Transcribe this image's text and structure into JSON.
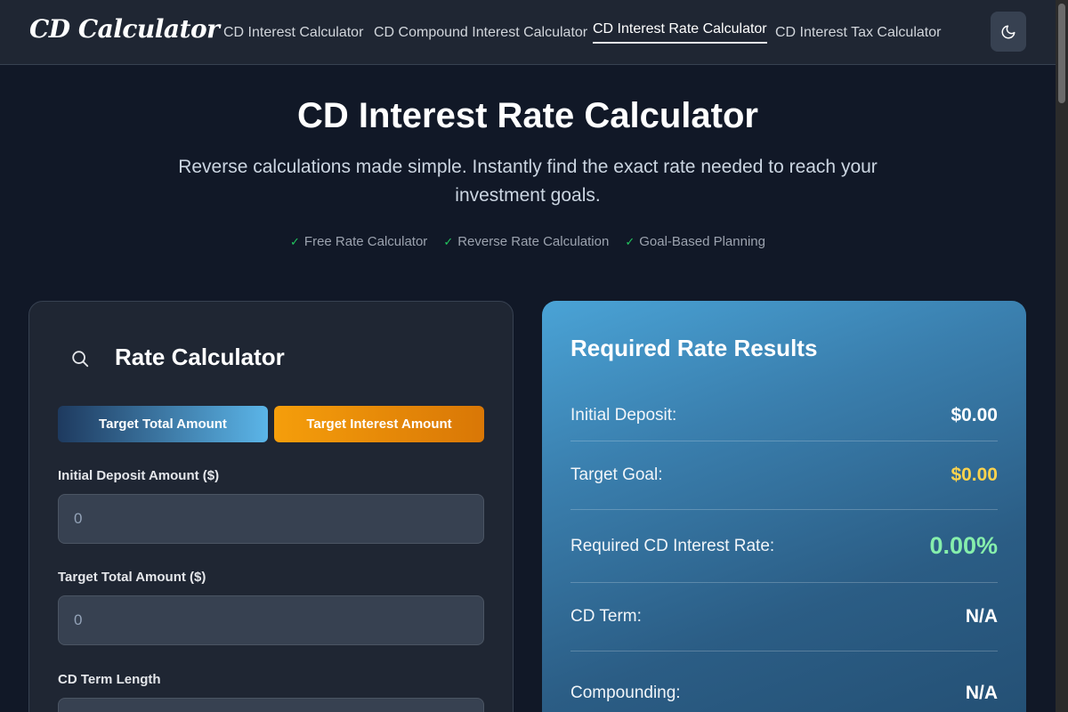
{
  "header": {
    "logo": "CD Calculator",
    "nav": [
      {
        "label": "CD Interest Calculator"
      },
      {
        "label": "CD Compound Interest Calculator"
      },
      {
        "label": "CD Interest Rate Calculator",
        "active": true
      },
      {
        "label": "CD Interest Tax Calculator"
      }
    ],
    "theme_toggle_icon": "moon-icon"
  },
  "hero": {
    "title": "CD Interest Rate Calculator",
    "subtitle": "Reverse calculations made simple. Instantly find the exact rate needed to reach your investment goals.",
    "features": [
      "Free Rate Calculator",
      "Reverse Rate Calculation",
      "Goal-Based Planning"
    ]
  },
  "calculator": {
    "title": "Rate Calculator",
    "icon": "search-icon",
    "modes": [
      "Target Total Amount",
      "Target Interest Amount"
    ],
    "fields": [
      {
        "label": "Initial Deposit Amount ($)",
        "placeholder": "0"
      },
      {
        "label": "Target Total Amount ($)",
        "placeholder": "0"
      },
      {
        "label": "CD Term Length",
        "placeholder": ""
      }
    ]
  },
  "results": {
    "title": "Required Rate Results",
    "rows": [
      {
        "label": "Initial Deposit:",
        "value": "$0.00"
      },
      {
        "label": "Target Goal:",
        "value": "$0.00"
      },
      {
        "label": "Required CD Interest Rate:",
        "value": "0.00%"
      },
      {
        "label": "CD Term:",
        "value": "N/A"
      },
      {
        "label": "Compounding:",
        "value": "N/A"
      }
    ]
  },
  "colors": {
    "background": "#111827",
    "accent_orange": "#f59e0b",
    "accent_blue": "#5bb5e8",
    "goal_gold": "#fcd34d",
    "rate_green": "#86efac",
    "check_green": "#22c55e"
  }
}
